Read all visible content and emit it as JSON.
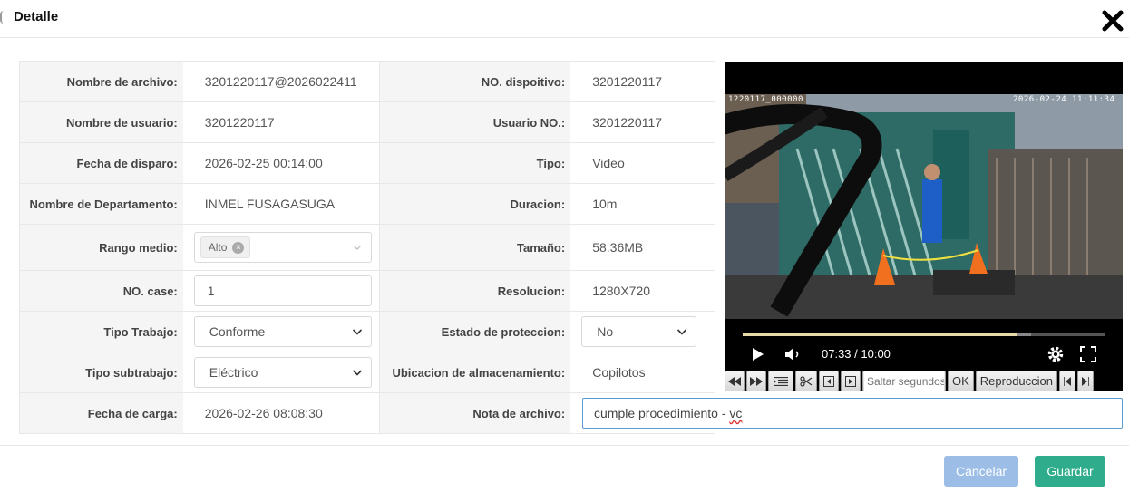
{
  "dialog": {
    "title": "Detalle"
  },
  "fields": {
    "nombre_archivo": {
      "label": "Nombre de archivo:",
      "value": "3201220117@2026022411"
    },
    "no_dispositivo": {
      "label": "NO. dispoitivo:",
      "value": "3201220117"
    },
    "nombre_usuario": {
      "label": "Nombre de usuario:",
      "value": "3201220117"
    },
    "usuario_no": {
      "label": "Usuario NO.:",
      "value": "3201220117"
    },
    "fecha_disparo": {
      "label": "Fecha de disparo:",
      "value": "2026-02-25 00:14:00"
    },
    "tipo": {
      "label": "Tipo:",
      "value": "Video"
    },
    "departamento": {
      "label": "Nombre de Departamento:",
      "value": "INMEL FUSAGASUGA"
    },
    "duracion": {
      "label": "Duracion:",
      "value": "10m"
    },
    "rango_medio": {
      "label": "Rango medio:",
      "tag": "Alto"
    },
    "tamano": {
      "label": "Tamaño:",
      "value": "58.36MB"
    },
    "no_case": {
      "label": "NO. case:",
      "value": "1"
    },
    "resolucion": {
      "label": "Resolucion:",
      "value": "1280X720"
    },
    "tipo_trabajo": {
      "label": "Tipo Trabajo:",
      "value": "Conforme"
    },
    "estado_proteccion": {
      "label": "Estado de proteccion:",
      "value": "No"
    },
    "tipo_subtrabajo": {
      "label": "Tipo subtrabajo:",
      "value": "Eléctrico"
    },
    "ubicacion": {
      "label": "Ubicacion de almacenamiento:",
      "value": "Copilotos"
    },
    "fecha_carga": {
      "label": "Fecha de carga:",
      "value": "2026-02-26 08:08:30"
    },
    "nota_archivo": {
      "label": "Nota de archivo:",
      "value_text": "cumple procedimiento - ",
      "value_misspelled": "vc"
    }
  },
  "video": {
    "osd_left": "1220117_000000",
    "osd_right": "2026-02-24 11:11:34",
    "time": "07:33 / 10:00",
    "progress": 0.755,
    "buffered": 0.795
  },
  "toolbar": {
    "seek_placeholder": "Saltar segundos",
    "ok_label": "OK",
    "playback_label": "Reproduccion"
  },
  "footer": {
    "cancel_label": "Cancelar",
    "save_label": "Guardar"
  },
  "colors": {
    "save": "#2fac8c",
    "cancel": "#9bbde6",
    "focus_border": "#5b9bd5"
  },
  "icons": [
    "close-icon",
    "chevron-down-icon",
    "play-icon",
    "volume-icon",
    "settings-icon",
    "fullscreen-icon",
    "rewind-icon",
    "fast-forward-icon",
    "playlist-icon",
    "scissors-icon",
    "frame-back-icon",
    "frame-forward-icon",
    "skip-start-icon",
    "skip-end-icon"
  ]
}
